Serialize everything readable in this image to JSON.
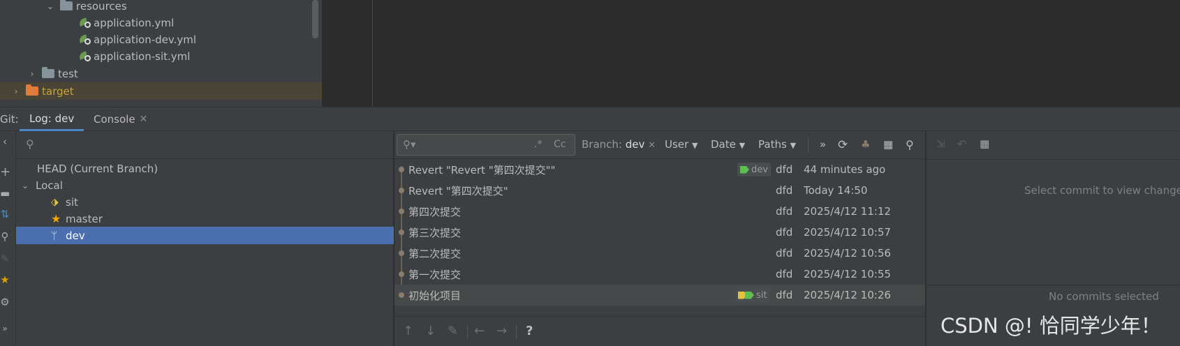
{
  "project_tree": {
    "items": [
      {
        "label": "resources",
        "type": "folder"
      },
      {
        "label": "application.yml",
        "type": "yml"
      },
      {
        "label": "application-dev.yml",
        "type": "yml"
      },
      {
        "label": "application-sit.yml",
        "type": "yml"
      },
      {
        "label": "test",
        "type": "folder"
      },
      {
        "label": "target",
        "type": "folder-excluded"
      }
    ]
  },
  "tool_window": {
    "prefix": "Git:",
    "tabs": [
      {
        "label": "Log: dev",
        "active": true
      },
      {
        "label": "Console",
        "active": false,
        "closable": true
      }
    ]
  },
  "branches": {
    "search_placeholder": "",
    "items": [
      {
        "label": "HEAD (Current Branch)",
        "icon": "none"
      },
      {
        "label": "Local",
        "icon": "expand-arrow"
      },
      {
        "label": "sit",
        "icon": "tag-icon"
      },
      {
        "label": "master",
        "icon": "star-icon"
      },
      {
        "label": "dev",
        "icon": "branch-icon",
        "selected": true
      }
    ]
  },
  "log": {
    "filter": {
      "regex_symbol": ".*",
      "case_symbol": "Cc",
      "branch_label": "Branch:",
      "branch_value": "dev",
      "user_label": "User",
      "date_label": "Date",
      "paths_label": "Paths",
      "more_symbol": "»"
    },
    "commits": [
      {
        "message": "Revert \"Revert \"第四次提交\"\"",
        "ref": "dev",
        "author": "dfd",
        "date": "44 minutes ago"
      },
      {
        "message": "Revert \"第四次提交\"",
        "ref": "",
        "author": "dfd",
        "date": "Today 14:50"
      },
      {
        "message": "第四次提交",
        "ref": "",
        "author": "dfd",
        "date": "2025/4/12 11:12"
      },
      {
        "message": "第三次提交",
        "ref": "",
        "author": "dfd",
        "date": "2025/4/12 10:57"
      },
      {
        "message": "第二次提交",
        "ref": "",
        "author": "dfd",
        "date": "2025/4/12 10:56"
      },
      {
        "message": "第一次提交",
        "ref": "",
        "author": "dfd",
        "date": "2025/4/12 10:55"
      },
      {
        "message": "初始化项目",
        "ref": "sit",
        "author": "dfd",
        "date": "2025/4/12 10:26"
      }
    ],
    "bottom_help": "?"
  },
  "details": {
    "select_hint": "Select commit to view changes",
    "no_commits": "No commits selected"
  },
  "watermark": "CSDN @! 恰同学少年！",
  "colors": {
    "accent": "#4a88c7",
    "selection": "#4b6eaf",
    "panel": "#3c3f41",
    "tag_green": "#5cbf50",
    "tag_yellow": "#e0c341"
  }
}
